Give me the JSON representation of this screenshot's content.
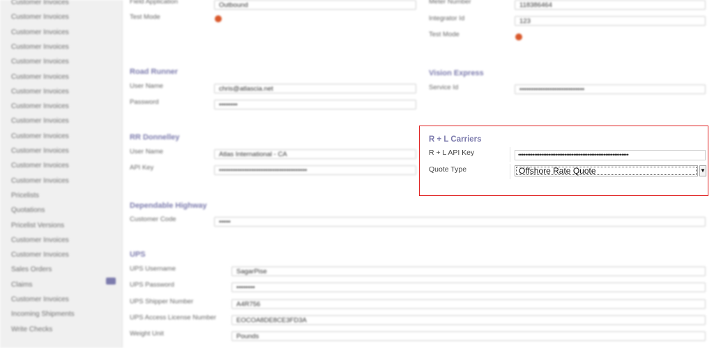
{
  "sidebar": {
    "items": [
      "Customer Invoices",
      "Customer Invoices",
      "Customer Invoices",
      "Customer Invoices",
      "Customer Invoices",
      "Customer Invoices",
      "Customer Invoices",
      "Customer Invoices",
      "Customer Invoices",
      "Customer Invoices",
      "Customer Invoices",
      "Customer Invoices",
      "Customer Invoices",
      "Pricelists",
      "Quotations",
      "Pricelist Versions",
      "Customer Invoices",
      "Customer Invoices",
      "Sales Orders",
      "Claims",
      "Customer Invoices",
      "Incoming Shipments",
      "Write Checks"
    ]
  },
  "top_left": {
    "label": "Field Application",
    "value": "Outbound",
    "test_mode_label": "Test Mode"
  },
  "top_right": {
    "meter_label": "Meter Number",
    "meter_value": "118386464",
    "integrator_label": "Integrator Id",
    "integrator_value": "123",
    "test_mode_label": "Test Mode"
  },
  "road_runner": {
    "title": "Road Runner",
    "user_label": "User Name",
    "user_value": "chris@atlascia.net",
    "password_label": "Password",
    "password_value": "••••••••"
  },
  "vision_express": {
    "title": "Vision Express",
    "service_label": "Service Id",
    "service_value": "••••••••••••••••••••••••••••"
  },
  "rr_donnelley": {
    "title": "RR Donnelley",
    "user_label": "User Name",
    "user_value": "Atlas International - CA",
    "api_label": "API Key",
    "api_value": "••••••••••••••••••••••••••••••••••••••"
  },
  "dependable": {
    "title": "Dependable Highway",
    "customer_label": "Customer Code",
    "customer_value": "•••••"
  },
  "ups": {
    "title": "UPS",
    "username_label": "UPS Username",
    "username_value": "SagarPise",
    "password_label": "UPS Password",
    "password_value": "••••••••",
    "shipper_label": "UPS Shipper Number",
    "shipper_value": "A4R756",
    "license_label": "UPS Access License Number",
    "license_value": "EOCOA8DE8CE3FD3A",
    "weight_label": "Weight Unit",
    "weight_value": "Pounds"
  },
  "rl_carriers": {
    "title": "R + L Carriers",
    "api_key_label": "R + L API Key",
    "api_key_value": "••••••••••••••••••••••••••••••••••••••••••••••••••••••••••••••",
    "quote_type_label": "Quote Type",
    "quote_type_value": "Offshore Rate Quote",
    "select_arrow": "▼",
    "highlight_color": "#e02020"
  },
  "colors": {
    "section_title": "#7c7bad",
    "toggle": "#d9582b"
  }
}
